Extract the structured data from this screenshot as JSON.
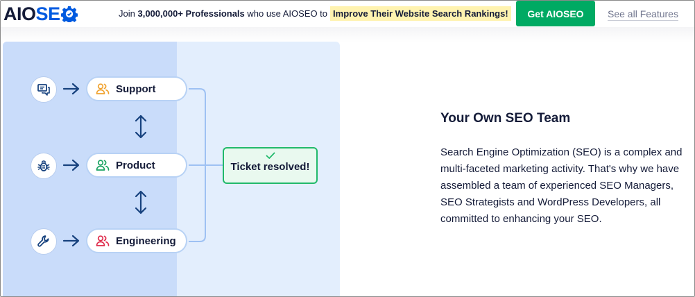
{
  "brand": {
    "logo_prefix": "AIO",
    "logo_suffix": "SE",
    "accent_color": "#005ae0"
  },
  "promo": {
    "prefix": "Join",
    "count": "3,000,000+ Professionals",
    "middle": "who use AIOSEO to",
    "highlight": "Improve Their Website Search Rankings!"
  },
  "cta": {
    "label": "Get AIOSEO",
    "color": "#00aa63"
  },
  "features_link": "See all Features",
  "flow": {
    "rows": [
      {
        "icon": "chat-icon",
        "team": "Support",
        "team_icon_color": "#f0a22e"
      },
      {
        "icon": "bug-icon",
        "team": "Product",
        "team_icon_color": "#1aa361"
      },
      {
        "icon": "wrench-icon",
        "team": "Engineering",
        "team_icon_color": "#df2a4a"
      }
    ],
    "result": "Ticket resolved!"
  },
  "section": {
    "title": "Your Own SEO Team",
    "body": "Search Engine Optimization (SEO) is a complex and multi-faceted marketing activity. That's why we have assembled a team of experienced SEO Managers, SEO Strategists and WordPress Developers, all committed to enhancing your SEO."
  }
}
